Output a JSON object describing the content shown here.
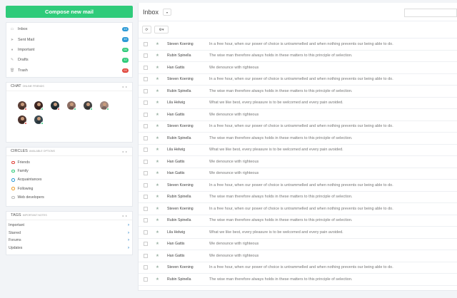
{
  "compose_label": "Compose new mail",
  "folders": [
    {
      "label": "Inbox",
      "icon": "inbox-icon",
      "glyph": "▭",
      "badge": "13",
      "color": "#2d9ad6"
    },
    {
      "label": "Sent Mail",
      "icon": "paper-plane-icon",
      "glyph": "➤",
      "badge": "10",
      "color": "#2d9ad6"
    },
    {
      "label": "Important",
      "icon": "important-icon",
      "glyph": "●",
      "badge": "05",
      "color": "#2fcb7a"
    },
    {
      "label": "Drafts",
      "icon": "drafts-icon",
      "glyph": "✎",
      "badge": "12",
      "color": "#2fcb7a"
    },
    {
      "label": "Trash",
      "icon": "trash-icon",
      "glyph": "🗑",
      "badge": "03",
      "color": "#e0443b"
    }
  ],
  "chat": {
    "title": "Chat",
    "subtitle": "online friends",
    "controls": "◂ ▸",
    "avatars": [
      {
        "bg": "#5d4037",
        "status": "#e0443b"
      },
      {
        "bg": "#3e2723",
        "status": "#2fcb7a"
      },
      {
        "bg": "#263238",
        "status": "#e0443b"
      },
      {
        "bg": "#8d6e63",
        "status": "#2fcb7a"
      },
      {
        "bg": "#424242",
        "status": "#2fcb7a"
      },
      {
        "bg": "#a1887f",
        "status": "#2fcb7a"
      },
      {
        "bg": "#4e342e",
        "status": "#e0443b"
      },
      {
        "bg": "#37474f",
        "status": "#2fcb7a"
      }
    ]
  },
  "circles": {
    "title": "Circles",
    "subtitle": "available options",
    "controls": "◂ ▸",
    "items": [
      {
        "label": "Friends",
        "color": "#e0443b"
      },
      {
        "label": "Family",
        "color": "#2fcb7a"
      },
      {
        "label": "Acquaintances",
        "color": "#2d9ad6"
      },
      {
        "label": "Following",
        "color": "#f0a030"
      },
      {
        "label": "Web developers",
        "color": "#bbbbbb"
      }
    ]
  },
  "tags": {
    "title": "Tags",
    "subtitle": "important notes",
    "controls": "◂ ▸",
    "items": [
      "Important",
      "Starred",
      "Forums",
      "Updates"
    ]
  },
  "mailbox": {
    "title": "Inbox",
    "dropdown": "▾",
    "refresh": "⟳",
    "gear": "⚙▾"
  },
  "messages": [
    {
      "sender": "Steven Koening",
      "subject": "In a free hour, when our power of choice is untrammelled and when nothing prevents our being able to do."
    },
    {
      "sender": "Rubin Spinella",
      "subject": "The wise man therefore always holds in these matters to this principle of selection."
    },
    {
      "sender": "Han Gattis",
      "subject": "We denounce with righteous"
    },
    {
      "sender": "Steven Koening",
      "subject": "In a free hour, when our power of choice is untrammelled and when nothing prevents our being able to do."
    },
    {
      "sender": "Rubin Spinella",
      "subject": "The wise man therefore always holds in these matters to this principle of selection."
    },
    {
      "sender": "Lila Helwig",
      "subject": "What we like best, every pleasure is to be welcomed and every pain avoided."
    },
    {
      "sender": "Han Gattis",
      "subject": "We denounce with righteous"
    },
    {
      "sender": "Steven Koening",
      "subject": "In a free hour, when our power of choice is untrammelled and when nothing prevents our being able to do."
    },
    {
      "sender": "Rubin Spinella",
      "subject": "The wise man therefore always holds in these matters to this principle of selection."
    },
    {
      "sender": "Lila Helwig",
      "subject": "What we like best, every pleasure is to be welcomed and every pain avoided."
    },
    {
      "sender": "Han Gattis",
      "subject": "We denounce with righteous"
    },
    {
      "sender": "Han Gattis",
      "subject": "We denounce with righteous"
    },
    {
      "sender": "Steven Koening",
      "subject": "In a free hour, when our power of choice is untrammelled and when nothing prevents our being able to do."
    },
    {
      "sender": "Rubin Spinella",
      "subject": "The wise man therefore always holds in these matters to this principle of selection."
    },
    {
      "sender": "Steven Koening",
      "subject": "In a free hour, when our power of choice is untrammelled and when nothing prevents our being able to do."
    },
    {
      "sender": "Rubin Spinella",
      "subject": "The wise man therefore always holds in these matters to this principle of selection."
    },
    {
      "sender": "Lila Helwig",
      "subject": "What we like best, every pleasure is to be welcomed and every pain avoided."
    },
    {
      "sender": "Han Gattis",
      "subject": "We denounce with righteous"
    },
    {
      "sender": "Han Gattis",
      "subject": "We denounce with righteous"
    },
    {
      "sender": "Steven Koening",
      "subject": "In a free hour, when our power of choice is untrammelled and when nothing prevents our being able to do."
    },
    {
      "sender": "Rubin Spinella",
      "subject": "The wise man therefore always holds in these matters to this principle of selection."
    }
  ]
}
